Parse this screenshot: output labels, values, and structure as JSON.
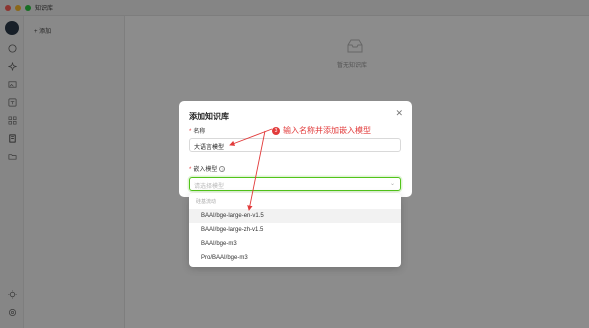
{
  "window": {
    "title": "知识库"
  },
  "kb_panel": {
    "add_label": "+ 添加"
  },
  "main": {
    "empty_text": "暂无知识库"
  },
  "modal": {
    "title": "添加知识库",
    "close_glyph": "✕",
    "name_label": "名称",
    "name_value": "大语言模型",
    "model_label": "嵌入模型",
    "model_placeholder": "请选择模型",
    "required_mark": "*"
  },
  "dropdown": {
    "group_label": "硅基流动",
    "options": [
      "BAAI/bge-large-en-v1.5",
      "BAAI/bge-large-zh-v1.5",
      "BAAI/bge-m3",
      "Pro/BAAI/bge-m3"
    ],
    "highlighted_index": 0
  },
  "annotation": {
    "number": "3",
    "text": "输入名称并添加嵌入模型",
    "color": "#e23b3b"
  },
  "rail_icons": [
    "chat-icon",
    "sparkle-icon",
    "image-icon",
    "translate-icon",
    "apps-icon",
    "knowledge-icon",
    "folder-icon",
    "theme-icon",
    "settings-icon"
  ]
}
